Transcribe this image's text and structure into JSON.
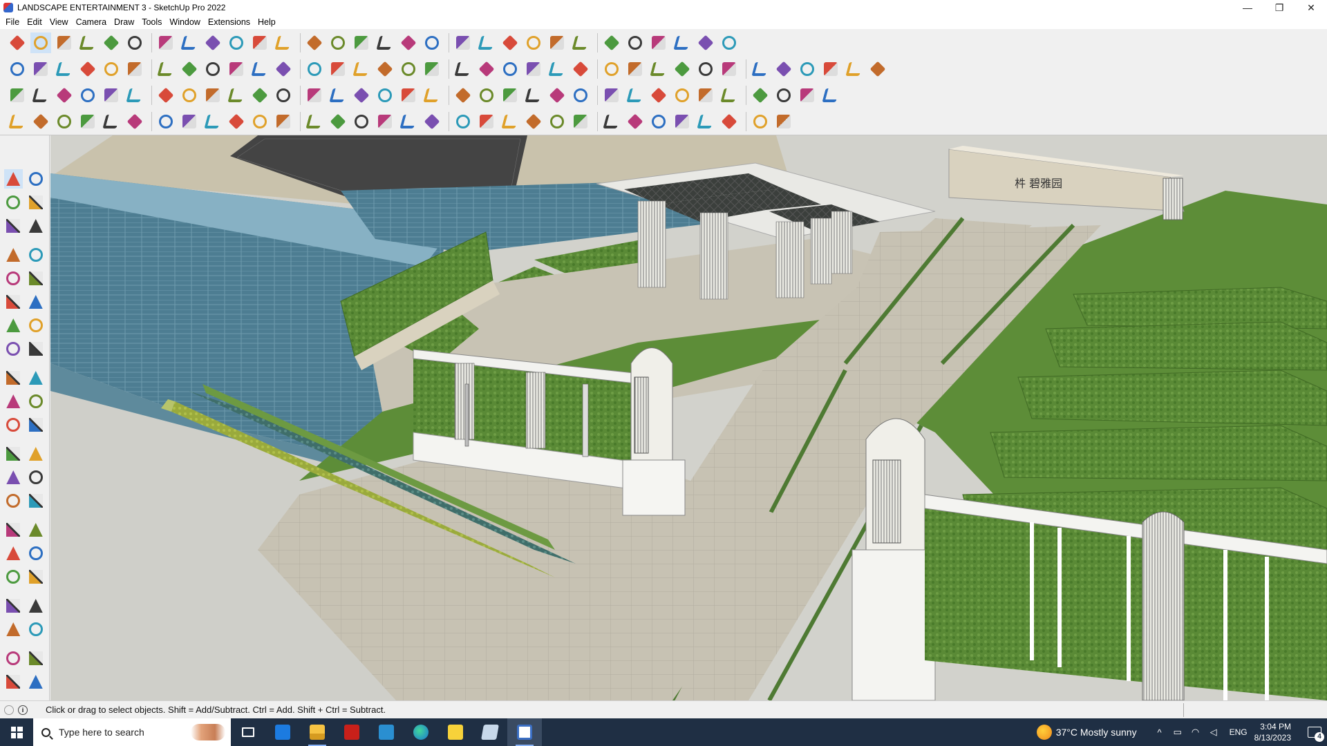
{
  "window": {
    "title": "LANDSCAPE ENTERTAINMENT 3 - SketchUp Pro 2022",
    "controls": {
      "minimize": "—",
      "restore": "❐",
      "close": "✕"
    }
  },
  "menu": [
    "File",
    "Edit",
    "View",
    "Camera",
    "Draw",
    "Tools",
    "Window",
    "Extensions",
    "Help"
  ],
  "status": {
    "hint": "Click or drag to select objects. Shift = Add/Subtract. Ctrl = Add. Shift + Ctrl = Subtract.",
    "info_icon": "i"
  },
  "taskbar": {
    "search_placeholder": "Type here to search",
    "apps": [
      "task-view",
      "calculator",
      "file-explorer",
      "acrobat",
      "sketchup-layout-3",
      "edge",
      "sticky-notes",
      "sketchup-style-builder",
      "sketchup-2022"
    ],
    "weather": {
      "temp": "37°C",
      "condition": "Mostly sunny"
    },
    "language": "ENG",
    "time": "3:04 PM",
    "date": "8/13/2023",
    "notifications": "4"
  },
  "colors": {
    "accent_select": "#cfe3f7",
    "grass": "#5f8f3a",
    "water": "#4f7f94",
    "paving": "#cbc6b8",
    "taskbar": "#1f2f44"
  },
  "toolbar_icons": {
    "row1": [
      "zoom",
      "select",
      "eraser",
      "pencil",
      "arc",
      "shape",
      "push-pull",
      "follow-me",
      "move",
      "rotate",
      "scale",
      "tape",
      "text",
      "paint",
      "orbit",
      "pan",
      "zoom-tool",
      "zoom-extents",
      "components",
      "materials",
      "styles",
      "layers",
      "warehouse",
      "extension",
      "section",
      "export",
      "geo"
    ],
    "row2": [
      "iso",
      "top",
      "front",
      "right",
      "back",
      "left",
      "bottom",
      "xray",
      "wire",
      "hidden",
      "shaded",
      "textured",
      "mono",
      "sandbox-contours",
      "sandbox-scratch",
      "stamp",
      "drape",
      "flip",
      "house",
      "door",
      "window",
      "arc-tools",
      "bezier",
      "selection-tools"
    ],
    "row3": [
      "solid-tools",
      "union",
      "subtract",
      "trim",
      "split",
      "round-corner",
      "joint-push",
      "weld",
      "curve-maker",
      "fillet",
      "explode",
      "intersect",
      "follow",
      "extrude",
      "curviloft",
      "cleanup",
      "instant-road",
      "profile",
      "stair",
      "wall",
      "roof",
      "terrain"
    ],
    "row4": [
      "grid",
      "spline",
      "vertex",
      "tools",
      "edge-tools",
      "polyline",
      "arc2",
      "loft",
      "rail",
      "twist",
      "lattice",
      "fence",
      "truss",
      "pillar",
      "railing",
      "shingle",
      "stack",
      "array",
      "copy-along",
      "scatter",
      "place"
    ]
  },
  "left_tools": [
    [
      "select-icon",
      "orbit-icon"
    ],
    [
      "paint-bucket-icon",
      "eraser-icon"
    ],
    [
      "components-icon",
      "tape-icon"
    ],
    [
      "line-icon",
      "freehand-icon"
    ],
    [
      "rectangle-icon",
      "rotated-rect-icon"
    ],
    [
      "circle-icon",
      "polygon-icon"
    ],
    [
      "arc-icon",
      "two-point-arc-icon"
    ],
    [
      "pie-icon",
      "three-point-arc-icon"
    ],
    [
      "move-icon",
      "push-pull-icon"
    ],
    [
      "rotate-icon",
      "follow-me-icon"
    ],
    [
      "scale-icon",
      "offset-icon"
    ],
    [
      "tape-measure-icon",
      "dimension-icon"
    ],
    [
      "protractor-icon",
      "text-icon"
    ],
    [
      "axes-icon",
      "3d-text-icon"
    ],
    [
      "orbit-tool-icon",
      "pan-icon"
    ],
    [
      "zoom-icon",
      "zoom-window-icon"
    ],
    [
      "zoom-extents-icon",
      "previous-view-icon"
    ],
    [
      "position-camera-icon",
      "look-around-icon"
    ],
    [
      "walk-icon",
      "section-plane-icon"
    ],
    [
      "warehouse-icon",
      "extension-warehouse-icon"
    ],
    [
      "layout-icon",
      "extension-manager-icon"
    ]
  ]
}
